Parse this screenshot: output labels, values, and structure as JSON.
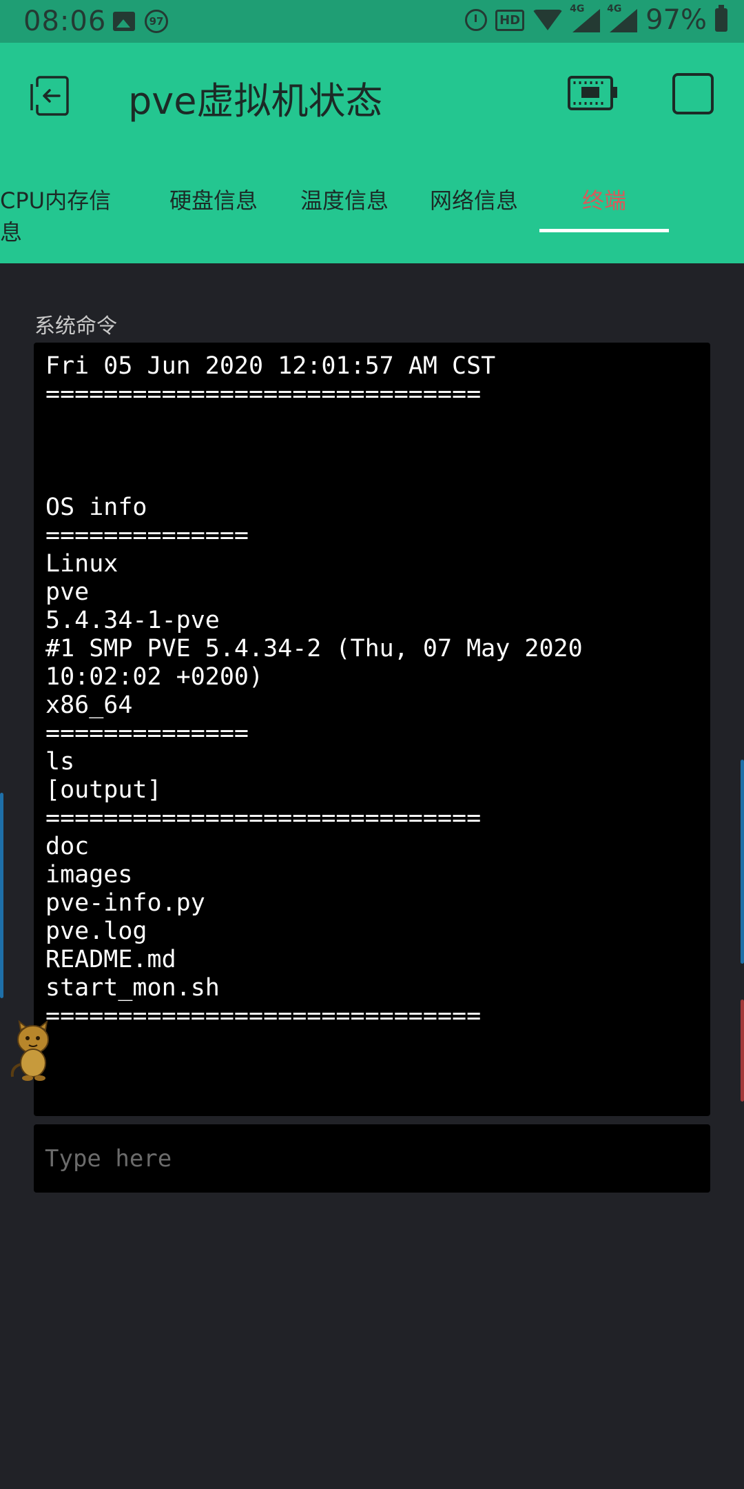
{
  "status_bar": {
    "time": "08:06",
    "notification_badge": "97",
    "hd_label": "HD",
    "signal_label_1": "4G",
    "signal_label_2": "4G",
    "battery_text": "97%"
  },
  "app_bar": {
    "title": "pve虚拟机状态"
  },
  "tabs": [
    {
      "label": "CPU内存信息",
      "active": false
    },
    {
      "label": "硬盘信息",
      "active": false
    },
    {
      "label": "温度信息",
      "active": false
    },
    {
      "label": "网络信息",
      "active": false
    },
    {
      "label": "终端",
      "active": true
    }
  ],
  "section_label": "系统命令",
  "terminal": {
    "lines": [
      "Fri 05 Jun 2020 12:01:57 AM CST",
      "==============================",
      "",
      "",
      "",
      "OS info",
      "==============",
      "Linux",
      "pve",
      "5.4.34-1-pve",
      "#1 SMP PVE 5.4.34-2 (Thu, 07 May 2020",
      "10:02:02 +0200)",
      "x86_64",
      "==============",
      "ls",
      "[output]",
      "==============================",
      "doc",
      "images",
      "pve-info.py",
      "pve.log",
      "README.md",
      "start_mon.sh",
      "=============================="
    ]
  },
  "input": {
    "placeholder": "Type here",
    "value": ""
  },
  "colors": {
    "header": "#24c690",
    "status_bar": "#1f9e74",
    "background": "#212227",
    "active_tab": "#d85a5a",
    "terminal_bg": "#000000"
  }
}
